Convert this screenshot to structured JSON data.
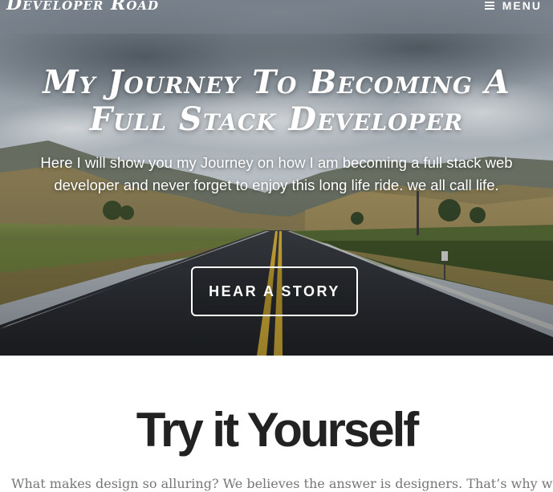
{
  "header": {
    "brand": "Developer Road",
    "menu_label": "MENU",
    "menu_icon": "hamburger-icon"
  },
  "hero": {
    "title": "My Journey To Becoming A Full Stack Developer",
    "subtitle": "Here I will show you my Journey on how I am becoming a full stack web developer and never forget to enjoy this long life ride. we all call life.",
    "button_label": "HEAR A STORY"
  },
  "section": {
    "title": "Try it Yourself",
    "text": "What makes design so alluring? We believes the answer is designers. That’s why we"
  },
  "colors": {
    "heading_dark": "#222222",
    "body_text": "#777777",
    "hero_text": "#ffffff"
  }
}
